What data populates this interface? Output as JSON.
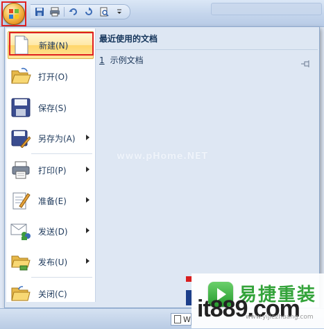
{
  "quick_access": {
    "icons": [
      "save-icon",
      "print-icon",
      "undo-icon",
      "redo-icon",
      "print-preview-icon",
      "customize-icon"
    ]
  },
  "menu": {
    "commands": [
      {
        "label": "新建(N)",
        "icon": "new-document-icon",
        "submenu": false,
        "active": true
      },
      {
        "label": "打开(O)",
        "icon": "open-folder-icon",
        "submenu": false,
        "active": false
      },
      {
        "label": "保存(S)",
        "icon": "save-disk-icon",
        "submenu": false,
        "active": false
      },
      {
        "label": "另存为(A)",
        "icon": "save-as-icon",
        "submenu": true,
        "active": false
      },
      {
        "label": "打印(P)",
        "icon": "printer-icon",
        "submenu": true,
        "active": false
      },
      {
        "label": "准备(E)",
        "icon": "prepare-icon",
        "submenu": true,
        "active": false
      },
      {
        "label": "发送(D)",
        "icon": "send-icon",
        "submenu": true,
        "active": false
      },
      {
        "label": "发布(U)",
        "icon": "publish-icon",
        "submenu": true,
        "active": false
      },
      {
        "label": "关闭(C)",
        "icon": "close-folder-icon",
        "submenu": false,
        "active": false
      }
    ],
    "recent": {
      "header": "最近使用的文档",
      "items": [
        {
          "number": "1",
          "name": "示例文档"
        }
      ]
    }
  },
  "watermark": "www.pHome.NET",
  "taskbar": {
    "doc_tab": "W"
  },
  "corner_logo": {
    "brand_cn": "易捷重装",
    "url": "it889.com",
    "small": "www.yijiezhuang.com"
  },
  "colors": {
    "highlight_box": "#e02020",
    "active_item": "#ffe39c",
    "menu_bg": "#dee7f3",
    "logo_green": "#33a33a"
  }
}
